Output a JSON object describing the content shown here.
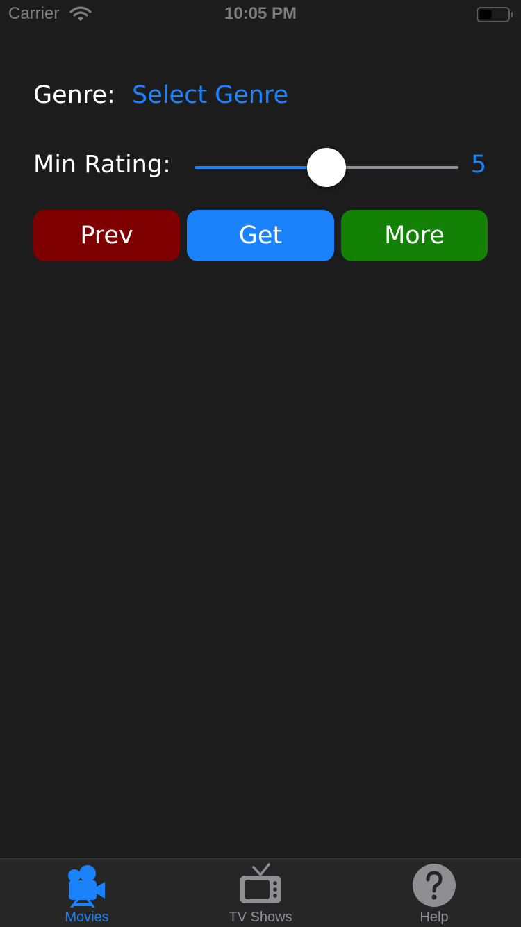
{
  "status_bar": {
    "carrier": "Carrier",
    "time": "10:05 PM"
  },
  "genre": {
    "label": "Genre:",
    "value": "Select Genre"
  },
  "rating": {
    "label": "Min Rating:",
    "value": "5",
    "min": 0,
    "max": 10,
    "current": 5
  },
  "buttons": {
    "prev": "Prev",
    "get": "Get",
    "more": "More"
  },
  "tabs": [
    {
      "label": "Movies",
      "icon": "movie-camera-icon",
      "active": true
    },
    {
      "label": "TV Shows",
      "icon": "tv-icon",
      "active": false
    },
    {
      "label": "Help",
      "icon": "question-mark-icon",
      "active": false
    }
  ],
  "colors": {
    "background": "#1c1c1c",
    "accent": "#1a82fb",
    "prev": "#7f0000",
    "get": "#1a82fb",
    "more": "#138006",
    "tab_bar": "#262626",
    "inactive": "#8e8e93"
  }
}
